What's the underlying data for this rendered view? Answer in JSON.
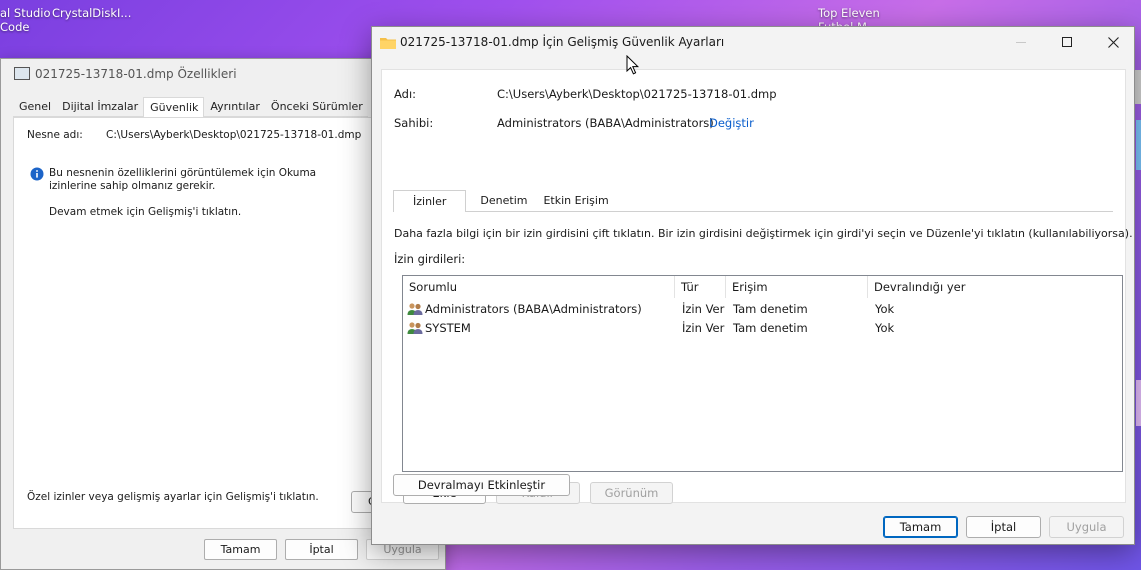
{
  "desktop": {
    "icons": [
      {
        "label_line1": "al Studio",
        "label_line2": "Code"
      },
      {
        "label_line1": "CrystalDiskI..."
      },
      {
        "label_line1": "Top Eleven",
        "label_line2": "Futbol M..."
      }
    ]
  },
  "properties_window": {
    "title": "021725-13718-01.dmp Özellikleri",
    "tabs": [
      "Genel",
      "Dijital İmzalar",
      "Güvenlik",
      "Ayrıntılar",
      "Önceki Sürümler"
    ],
    "active_tab": "Güvenlik",
    "object_name_label": "Nesne adı:",
    "object_name_value": "C:\\Users\\Ayberk\\Desktop\\021725-13718-01.dmp",
    "info_message": "Bu nesnenin özelliklerini görüntülemek için Okuma izinlerine sahip olmanız gerekir.",
    "continue_message": "Devam etmek için Gelişmiş'i tıklatın.",
    "special_permissions_text": "Özel izinler veya gelişmiş ayarlar için Gelişmiş'i tıklatın.",
    "advanced_button_partial": "G",
    "ok_button": "Tamam",
    "cancel_button": "İptal",
    "apply_button": "Uygula"
  },
  "advanced_window": {
    "title": "021725-13718-01.dmp İçin Gelişmiş Güvenlik Ayarları",
    "name_label": "Adı:",
    "name_value": "C:\\Users\\Ayberk\\Desktop\\021725-13718-01.dmp",
    "owner_label": "Sahibi:",
    "owner_value": "Administrators (BABA\\Administrators)",
    "change_link": "Değiştir",
    "tabs": [
      "İzinler",
      "Denetim",
      "Etkin Erişim"
    ],
    "active_tab": "İzinler",
    "instructions": "Daha fazla bilgi için bir izin girdisini çift tıklatın. Bir izin girdisini değiştirmek için girdi'yi seçin ve Düzenle'yi tıklatın (kullanılabiliyorsa).",
    "entries_label": "İzin girdileri:",
    "columns": [
      "Sorumlu",
      "Tür",
      "Erişim",
      "Devralındığı yer"
    ],
    "entries": [
      {
        "principal": "Administrators (BABA\\Administrators)",
        "type": "İzin Ver",
        "access": "Tam denetim",
        "inherited_from": "Yok"
      },
      {
        "principal": "SYSTEM",
        "type": "İzin Ver",
        "access": "Tam denetim",
        "inherited_from": "Yok"
      }
    ],
    "add_button": "Ekle",
    "remove_button": "Kaldır",
    "view_button": "Görünüm",
    "enable_inheritance_button": "Devralmayı Etkinleştir",
    "ok_button": "Tamam",
    "cancel_button": "İptal",
    "apply_button": "Uygula"
  }
}
